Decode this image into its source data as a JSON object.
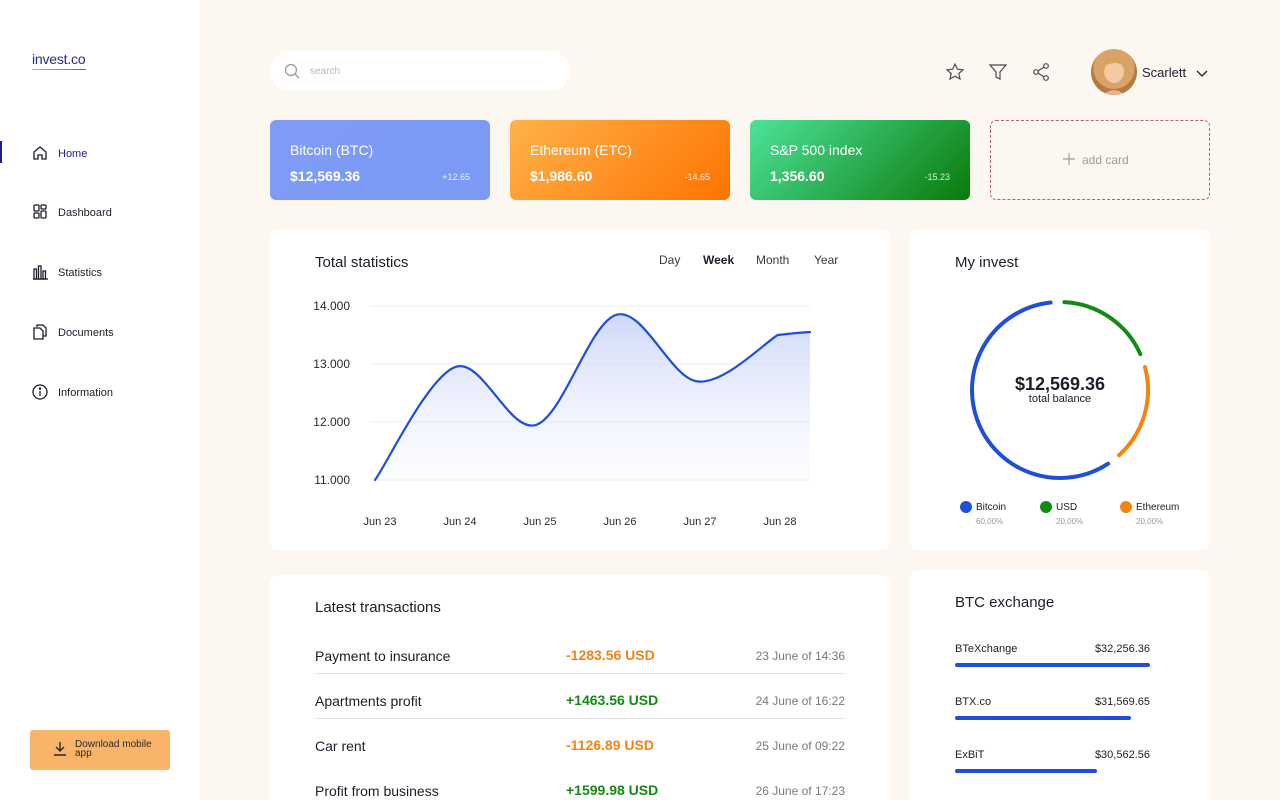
{
  "app": {
    "logo": "invest.co"
  },
  "sidebar": {
    "items": [
      {
        "label": "Home",
        "icon": "home-icon"
      },
      {
        "label": "Dashboard",
        "icon": "dashboard-icon"
      },
      {
        "label": "Statistics",
        "icon": "statistics-icon"
      },
      {
        "label": "Documents",
        "icon": "documents-icon"
      },
      {
        "label": "Information",
        "icon": "info-icon"
      }
    ],
    "active": "Home",
    "download_label": "Download mobile app"
  },
  "header": {
    "search_placeholder": "search",
    "user_name": "Scarlett",
    "icons": [
      "star-icon",
      "filter-icon",
      "share-icon"
    ]
  },
  "cards": [
    {
      "title": "Bitcoin (BTC)",
      "price": "$12,569.36",
      "change": "+12.65",
      "color_from": "#7f9cf6",
      "color_to": "#7a9af5"
    },
    {
      "title": "Ethereum (ETC)",
      "price": "$1,986.60",
      "change": "-14.65",
      "color_from": "#ffb24a",
      "color_to": "#ff7300"
    },
    {
      "title": "S&P 500 index",
      "price": "1,356.60",
      "change": "-15.23",
      "color_from": "#4de39a",
      "color_to": "#0a7a0a"
    }
  ],
  "add_card_label": "add card",
  "stats": {
    "title": "Total statistics",
    "periods": [
      "Day",
      "Week",
      "Month",
      "Year"
    ],
    "active_period": "Week"
  },
  "chart_data": {
    "type": "area",
    "categories": [
      "Jun 23",
      "Jun 24",
      "Jun 25",
      "Jun 26",
      "Jun 27",
      "Jun 28"
    ],
    "x": [
      0,
      1,
      2,
      3,
      4,
      5
    ],
    "series": [
      {
        "values": [
          11000,
          12950,
          11950,
          13850,
          12700,
          13500
        ]
      }
    ],
    "ylim": [
      11000,
      14000
    ],
    "yticks": [
      "14.000",
      "13.000",
      "12.000",
      "11.000"
    ],
    "color": "#1f4fd8",
    "grid": true
  },
  "invest": {
    "title": "My invest",
    "balance": "$12,569.36",
    "balance_label": "total balance",
    "segments": [
      {
        "name": "Bitcoin",
        "percent": "60,00%",
        "fraction": 0.6,
        "color": "#1f4fd8"
      },
      {
        "name": "USD",
        "percent": "20,00%",
        "fraction": 0.2,
        "color": "#138a13"
      },
      {
        "name": "Ethereum",
        "percent": "20,00%",
        "fraction": 0.2,
        "color": "#f5830f"
      }
    ]
  },
  "transactions": {
    "title": "Latest transactions",
    "rows": [
      {
        "description": "Payment to insurance",
        "amount": "-1283.56 USD",
        "date": "23 June of 14:36",
        "type": "out"
      },
      {
        "description": "Apartments profit",
        "amount": "+1463.56 USD",
        "date": "24 June of 16:22",
        "type": "in"
      },
      {
        "description": "Car rent",
        "amount": "-1126.89 USD",
        "date": "25 June of 09:22",
        "type": "out"
      },
      {
        "description": "Profit from business",
        "amount": "+1599.98 USD",
        "date": "26 June of 17:23",
        "type": "in"
      }
    ],
    "colors": {
      "in": "#138a13",
      "out": "#f5830f"
    }
  },
  "exchange": {
    "title": "BTC exchange",
    "rows": [
      {
        "name": "BTeXchange",
        "value": "$32,256.36",
        "fill": 1.0
      },
      {
        "name": "BTX.co",
        "value": "$31,569.65",
        "fill": 0.9
      },
      {
        "name": "ExBiT",
        "value": "$30,562.56",
        "fill": 0.73
      }
    ]
  }
}
